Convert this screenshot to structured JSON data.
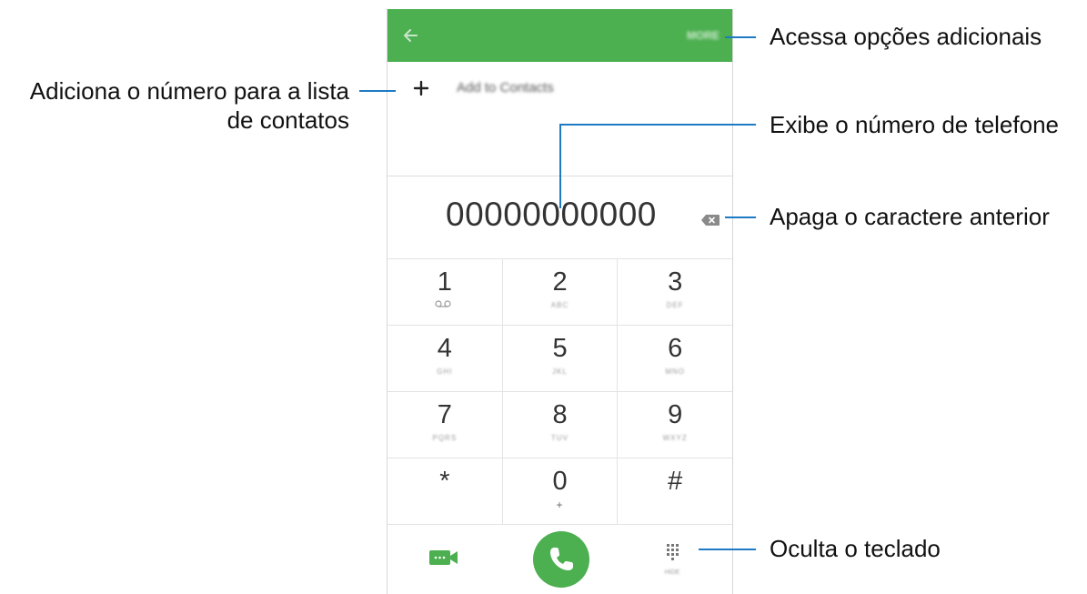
{
  "screen": {
    "appbar": {
      "more_label": "MORE",
      "accent_color": "#4caf50"
    },
    "add_to_contacts": {
      "label": "Add to Contacts"
    },
    "dialed_number": "00000000000",
    "keypad": [
      [
        {
          "digit": "1",
          "sub": ""
        },
        {
          "digit": "2",
          "sub": "ABC"
        },
        {
          "digit": "3",
          "sub": "DEF"
        }
      ],
      [
        {
          "digit": "4",
          "sub": "GHI"
        },
        {
          "digit": "5",
          "sub": "JKL"
        },
        {
          "digit": "6",
          "sub": "MNO"
        }
      ],
      [
        {
          "digit": "7",
          "sub": "PQRS"
        },
        {
          "digit": "8",
          "sub": "TUV"
        },
        {
          "digit": "9",
          "sub": "WXYZ"
        }
      ],
      [
        {
          "digit": "*",
          "sub": ""
        },
        {
          "digit": "0",
          "sub": "+"
        },
        {
          "digit": "#",
          "sub": ""
        }
      ]
    ],
    "hide_keypad_label": "HIDE",
    "icons": [
      "back-arrow-icon",
      "plus-icon",
      "backspace-icon",
      "voicemail-icon",
      "video-call-icon",
      "phone-icon",
      "dialpad-icon"
    ]
  },
  "callouts": {
    "more_options": "Acessa opções adicionais",
    "add_contact_line1": "Adiciona o número para a lista",
    "add_contact_line2": "de contatos",
    "show_number": "Exibe o número de telefone",
    "delete_char": "Apaga o caractere anterior",
    "hide_keypad": "Oculta o teclado"
  }
}
